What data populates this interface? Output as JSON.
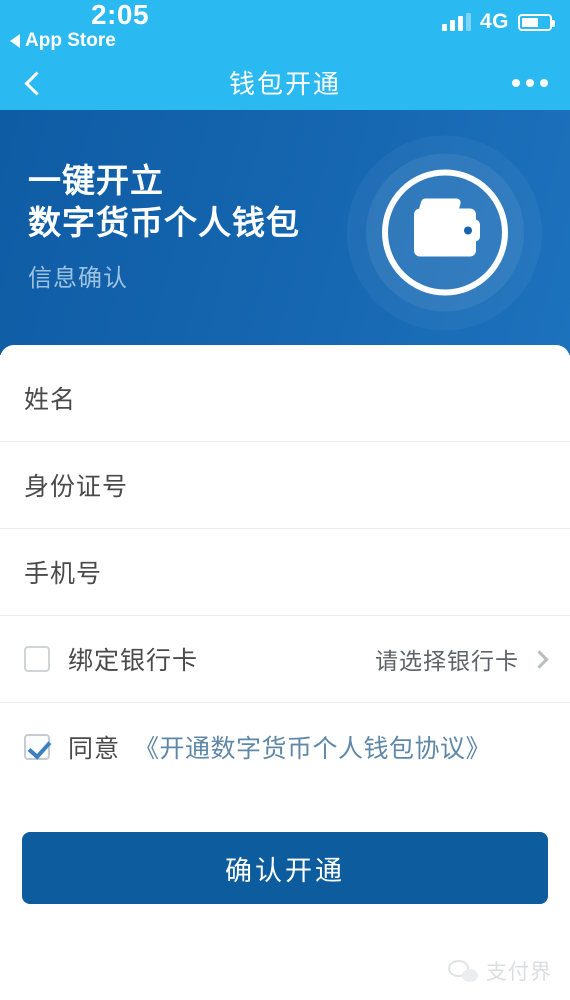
{
  "status_bar": {
    "time": "2:05",
    "return_label": "App Store",
    "network": "4G",
    "signal_bars_filled": 3,
    "signal_bars_total": 4,
    "battery_percent": 62
  },
  "nav_bar": {
    "title": "钱包开通",
    "back_icon": "chevron-left-icon",
    "more_icon": "more-dots-icon"
  },
  "hero": {
    "headline_line1": "一键开立",
    "headline_line2": "数字货币个人钱包",
    "subtitle": "信息确认",
    "icon": "wallet-icon",
    "gradient_from": "#0e5ca4",
    "gradient_to": "#1d72bd",
    "subtitle_color": "#9dc2e0"
  },
  "form": {
    "fields": [
      {
        "label": "姓名",
        "value": "",
        "placeholder": "姓名"
      },
      {
        "label": "身份证号",
        "value": "",
        "placeholder": "身份证号"
      },
      {
        "label": "手机号",
        "value": "",
        "placeholder": "手机号"
      }
    ],
    "bank_card": {
      "label": "绑定银行卡",
      "checked": false,
      "value": "请选择银行卡",
      "chevron": "chevron-right-icon"
    },
    "agreement": {
      "checked": true,
      "label": "同意",
      "link_text": "《开通数字货币个人钱包协议》",
      "link_color": "#5f88a8",
      "check_color": "#3d7ebe"
    }
  },
  "submit": {
    "label": "确认开通",
    "color": "#0c5c9e"
  },
  "watermark": {
    "text": "支付界",
    "icon": "wechat-icon"
  },
  "theme": {
    "status_bar_blue": "#2ab9f0",
    "nav_blue": "#2ab9f0",
    "card_bg": "#ffffff",
    "divider": "#eceff1"
  }
}
